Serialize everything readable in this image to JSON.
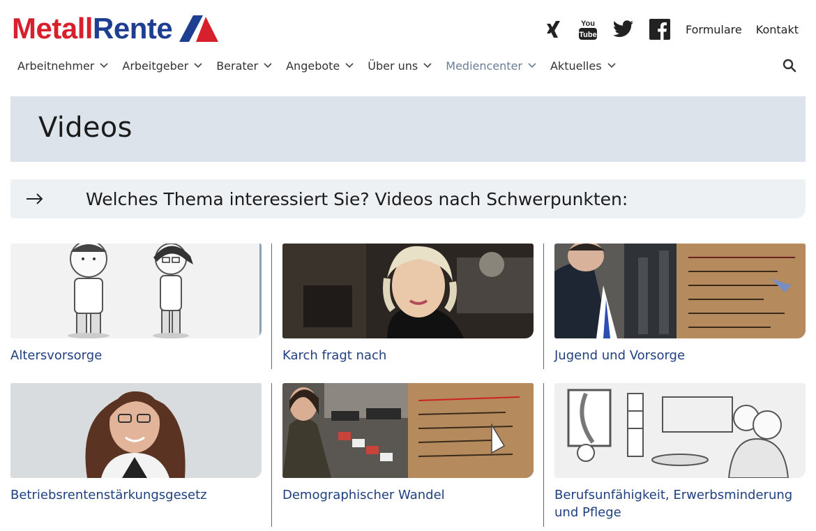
{
  "logo": {
    "part1": "Metall",
    "part2": "Rente"
  },
  "top_links": {
    "formulare": "Formulare",
    "kontakt": "Kontakt"
  },
  "social_icons": [
    "xing-icon",
    "youtube-icon",
    "twitter-icon",
    "facebook-icon"
  ],
  "youtube": {
    "line1": "You",
    "line2": "Tube"
  },
  "nav": [
    {
      "label": "Arbeitnehmer",
      "active": false
    },
    {
      "label": "Arbeitgeber",
      "active": false
    },
    {
      "label": "Berater",
      "active": false
    },
    {
      "label": "Angebote",
      "active": false
    },
    {
      "label": "Über uns",
      "active": false
    },
    {
      "label": "Mediencenter",
      "active": true
    },
    {
      "label": "Aktuelles",
      "active": false
    }
  ],
  "page": {
    "title": "Videos"
  },
  "topic_bar": {
    "text": "Welches Thema interessiert Sie? Videos nach Schwerpunkten:"
  },
  "videos": [
    {
      "label": "Altersvorsorge"
    },
    {
      "label": "Karch fragt nach"
    },
    {
      "label": "Jugend und Vorsorge"
    },
    {
      "label": "Betriebsrentenstärkungsgesetz"
    },
    {
      "label": "Demographischer Wandel"
    },
    {
      "label": "Berufsunfähigkeit, Erwerbsminderung und Pflege"
    }
  ],
  "colors": {
    "brand_red": "#d6202c",
    "brand_blue": "#1e3e92",
    "nav_active": "#6a7c98",
    "link_blue": "#1f3f7f",
    "title_band": "#dce3ea"
  }
}
